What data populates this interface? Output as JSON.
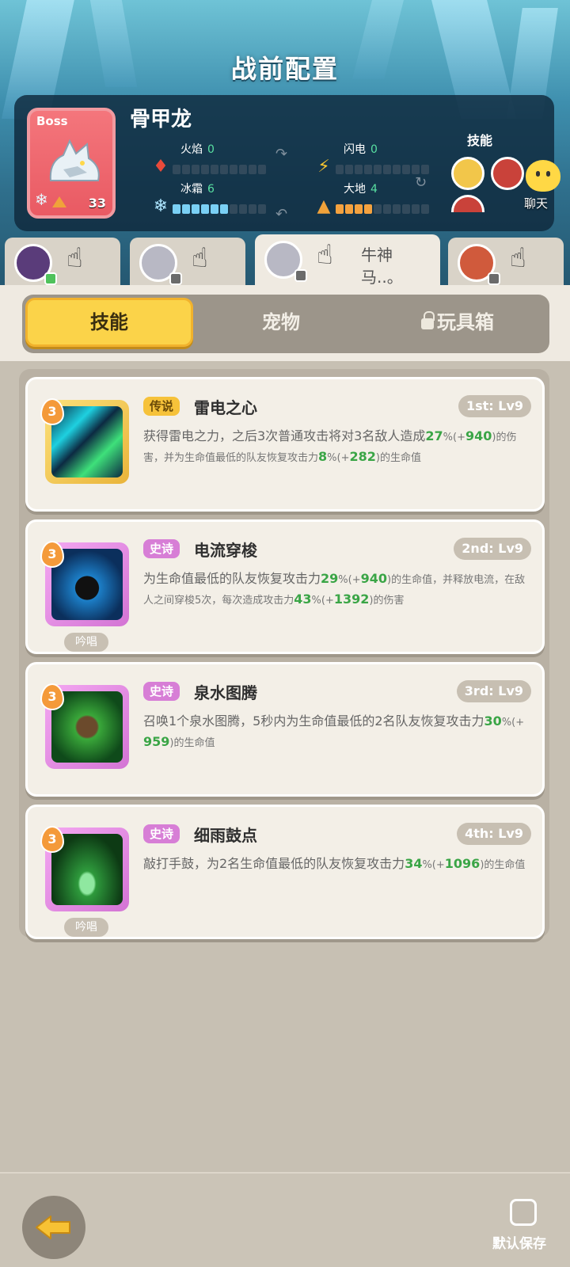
{
  "header": {
    "title": "战前配置"
  },
  "boss": {
    "tag": "Boss",
    "name": "骨甲龙",
    "level": "33",
    "elements": [
      {
        "label": "火焰",
        "value": "0",
        "icon": "flame-icon"
      },
      {
        "label": "闪电",
        "value": "0",
        "icon": "lightning-icon"
      },
      {
        "label": "冰霜",
        "value": "6",
        "icon": "snowflake-icon"
      },
      {
        "label": "大地",
        "value": "4",
        "icon": "earth-icon"
      }
    ],
    "skills_label": "技能"
  },
  "chat": {
    "label": "聊天"
  },
  "heroes": [
    {
      "name": "",
      "active": false
    },
    {
      "name": "",
      "active": false
    },
    {
      "name": "牛神马..。",
      "active": true
    },
    {
      "name": "",
      "active": false
    }
  ],
  "tabs": {
    "skills": "技能",
    "pets": "宠物",
    "toybox": "玩具箱"
  },
  "skills": [
    {
      "rarity": "传说",
      "name": "雷电之心",
      "slot": "1st: Lv9",
      "level": "3",
      "desc": [
        "获得雷电之力，之后3次普通攻击将对3名敌人造成",
        "27",
        "%(+",
        "940",
        ")的伤害，并为生命值最低的队友恢复攻击力",
        "8",
        "%(+",
        "282",
        ")的生命值"
      ],
      "chant": ""
    },
    {
      "rarity": "史诗",
      "name": "电流穿梭",
      "slot": "2nd: Lv9",
      "level": "3",
      "desc": [
        "为生命值最低的队友恢复攻击力",
        "29",
        "%(+",
        "940",
        ")的生命值，并释放电流，在敌人之间穿梭5次，每次造成攻击力",
        "43",
        "%(+",
        "1392",
        ")的伤害"
      ],
      "chant": "吟唱"
    },
    {
      "rarity": "史诗",
      "name": "泉水图腾",
      "slot": "3rd: Lv9",
      "level": "3",
      "desc": [
        "召唤1个泉水图腾，5秒内为生命值最低的2名队友恢复攻击力",
        "30",
        "%(+",
        "959",
        ")的生命值",
        "",
        "",
        "",
        ""
      ],
      "chant": ""
    },
    {
      "rarity": "史诗",
      "name": "细雨鼓点",
      "slot": "4th: Lv9",
      "level": "3",
      "desc": [
        "敲打手鼓，为2名生命值最低的队友恢复攻击力",
        "34",
        "%(+",
        "1096",
        ")的生命值",
        "",
        "",
        "",
        ""
      ],
      "chant": "吟唱"
    }
  ],
  "footer": {
    "save_label": "默认保存"
  },
  "colors": {
    "legend": "#f6c23a",
    "epic": "#d77ed6",
    "accent_green": "#3aa546",
    "tab_active": "#fbd349"
  }
}
